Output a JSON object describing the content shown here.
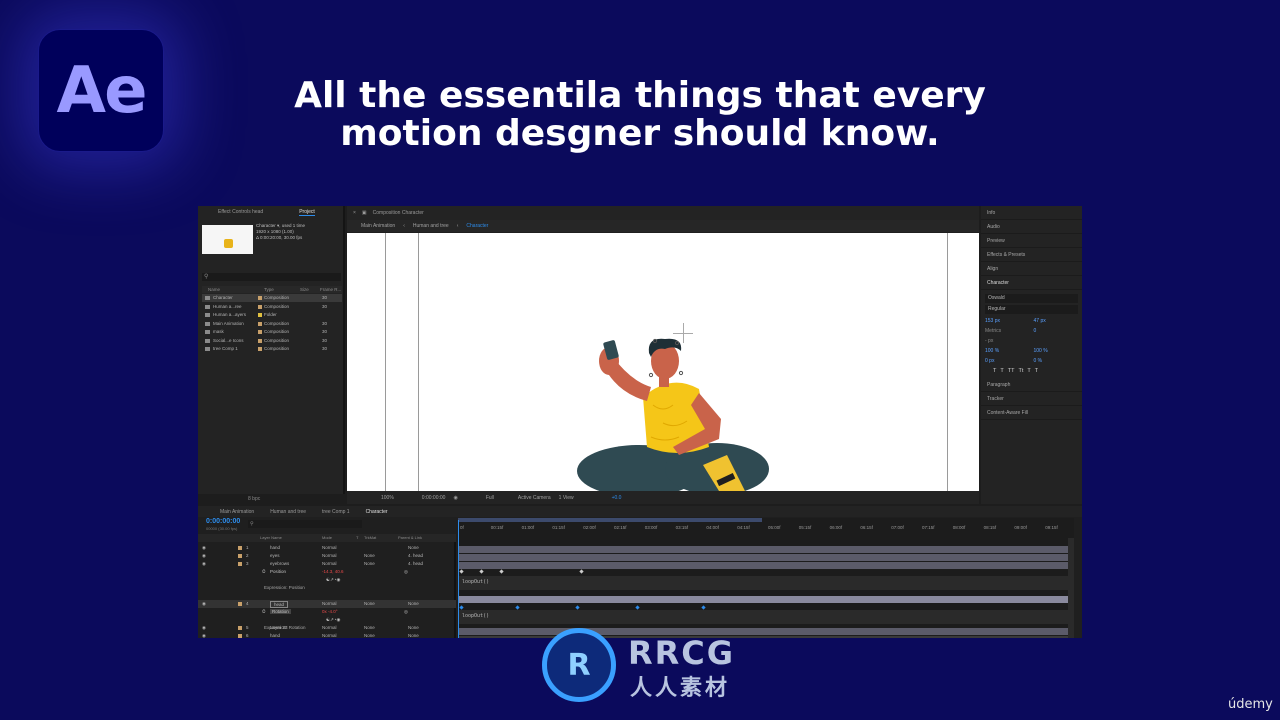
{
  "logo": {
    "text": "Ae"
  },
  "headline": {
    "line1": "All the essentila things that every",
    "line2": "motion desgner should know."
  },
  "project_panel": {
    "tabs": {
      "effect_controls": "Effect Controls head",
      "project": "Project"
    },
    "comp_name": "Character ▾",
    "comp_used": ", used 1 time",
    "comp_size": "1920 x 1080 (1.00)",
    "comp_duration": "Δ 0:00:20:00, 30.00 fps",
    "search_placeholder": "",
    "headers": {
      "name": "Name",
      "type": "Type",
      "size": "Size",
      "frame_rate": "Frame R..."
    },
    "items": [
      {
        "name": "Character",
        "type": "Composition",
        "rate": "30",
        "color": "#c8a06a"
      },
      {
        "name": "Human a...ree",
        "type": "Composition",
        "rate": "30",
        "color": "#c8a06a"
      },
      {
        "name": "Human a...ayers",
        "type": "Folder",
        "rate": "",
        "color": "#e0c040"
      },
      {
        "name": "Main Animation",
        "type": "Composition",
        "rate": "30",
        "color": "#c8a06a"
      },
      {
        "name": "mask",
        "type": "Composition",
        "rate": "30",
        "color": "#c8a06a"
      },
      {
        "name": "Social...e Icons",
        "type": "Composition",
        "rate": "30",
        "color": "#c8a06a"
      },
      {
        "name": "tree Comp 1",
        "type": "Composition",
        "rate": "30",
        "color": "#c8a06a"
      }
    ],
    "footer_bits": "8 bpc"
  },
  "comp_panel": {
    "tab_title": "Composition Character",
    "breadcrumb": [
      "Main Animation",
      "Human and tree",
      "Character"
    ],
    "footer": {
      "zoom": "100%",
      "time": "0:00:00:00",
      "resolution": "Full",
      "camera": "Active Camera",
      "views": "1 View",
      "exposure": "+0.0"
    }
  },
  "right_panel": {
    "items": [
      "Info",
      "Audio",
      "Preview",
      "Effects & Presets",
      "Align"
    ],
    "character": {
      "title": "Character",
      "font": "Oswald",
      "style": "Regular",
      "font_size": "153 px",
      "leading": "47 px",
      "tracking_label": "Metrics",
      "tracking": "0",
      "stroke": "- px",
      "vscale": "100 %",
      "hscale": "100 %",
      "baseline": "0 px",
      "tsume": "0 %",
      "style_buttons": [
        "T",
        "T",
        "TT",
        "Tt",
        "T",
        "T"
      ]
    },
    "bottom_items": [
      "Paragraph",
      "Tracker",
      "Content-Aware Fill"
    ]
  },
  "timeline": {
    "tabs": [
      "Main Animation",
      "Human and tree",
      "tree Comp 1",
      "Character"
    ],
    "time": "0:00:00:00",
    "time_sub": "00000 (30.00 fps)",
    "column_headers": {
      "layer_name": "Layer Name",
      "mode": "Mode",
      "t": "T",
      "trkmat": "TrkMat",
      "parent": "Parent & Link"
    },
    "ruler_ticks": [
      "0f",
      "00:15f",
      "01:00f",
      "01:15f",
      "02:00f",
      "02:15f",
      "03:00f",
      "03:15f",
      "04:00f",
      "04:15f",
      "05:00f",
      "05:15f",
      "06:00f",
      "06:15f",
      "07:00f",
      "07:15f",
      "08:00f",
      "08:15f",
      "09:00f",
      "09:15f"
    ],
    "layers": [
      {
        "num": "1",
        "name": "hand",
        "mode": "Normal",
        "trkmat": "",
        "parent": "None"
      },
      {
        "num": "2",
        "name": "eyes",
        "mode": "Normal",
        "trkmat": "None",
        "parent": "4. head"
      },
      {
        "num": "3",
        "name": "eyebrows",
        "mode": "Normal",
        "trkmat": "None",
        "parent": "4. head"
      }
    ],
    "position_prop": {
      "name": "Position",
      "value": "-14.3, 40.6"
    },
    "expression_position": "Expression: Position",
    "loop_out_1": "loopOut()",
    "layer4": {
      "num": "4",
      "name": "head",
      "mode": "Normal",
      "trkmat": "None",
      "parent": "None"
    },
    "rotation_prop": {
      "name": "Rotation",
      "value": "0x -4.0°"
    },
    "expression_rotation": "Expression: Rotation",
    "loop_out_2": "loopOut()",
    "bottom_layers": [
      {
        "num": "5",
        "name": "Layer 23",
        "mode": "Normal",
        "trkmat": "None",
        "parent": "None"
      },
      {
        "num": "6",
        "name": "hand",
        "mode": "Normal",
        "trkmat": "None",
        "parent": "None"
      }
    ]
  },
  "watermark": {
    "circle_text": "R",
    "title": "RRCG",
    "subtitle": "人人素材"
  },
  "udemy": "údemy",
  "colors": {
    "background": "#0b0a5c",
    "accent": "#2d8ceb",
    "ae_purple": "#9999ff",
    "shirt": "#f5c618",
    "skin": "#c9634a",
    "pants": "#2f4a52"
  },
  "icons": [
    "search-icon",
    "eye-icon",
    "lock-icon",
    "camera-icon",
    "fx-icon",
    "stopwatch-icon",
    "pickwhip-icon"
  ]
}
